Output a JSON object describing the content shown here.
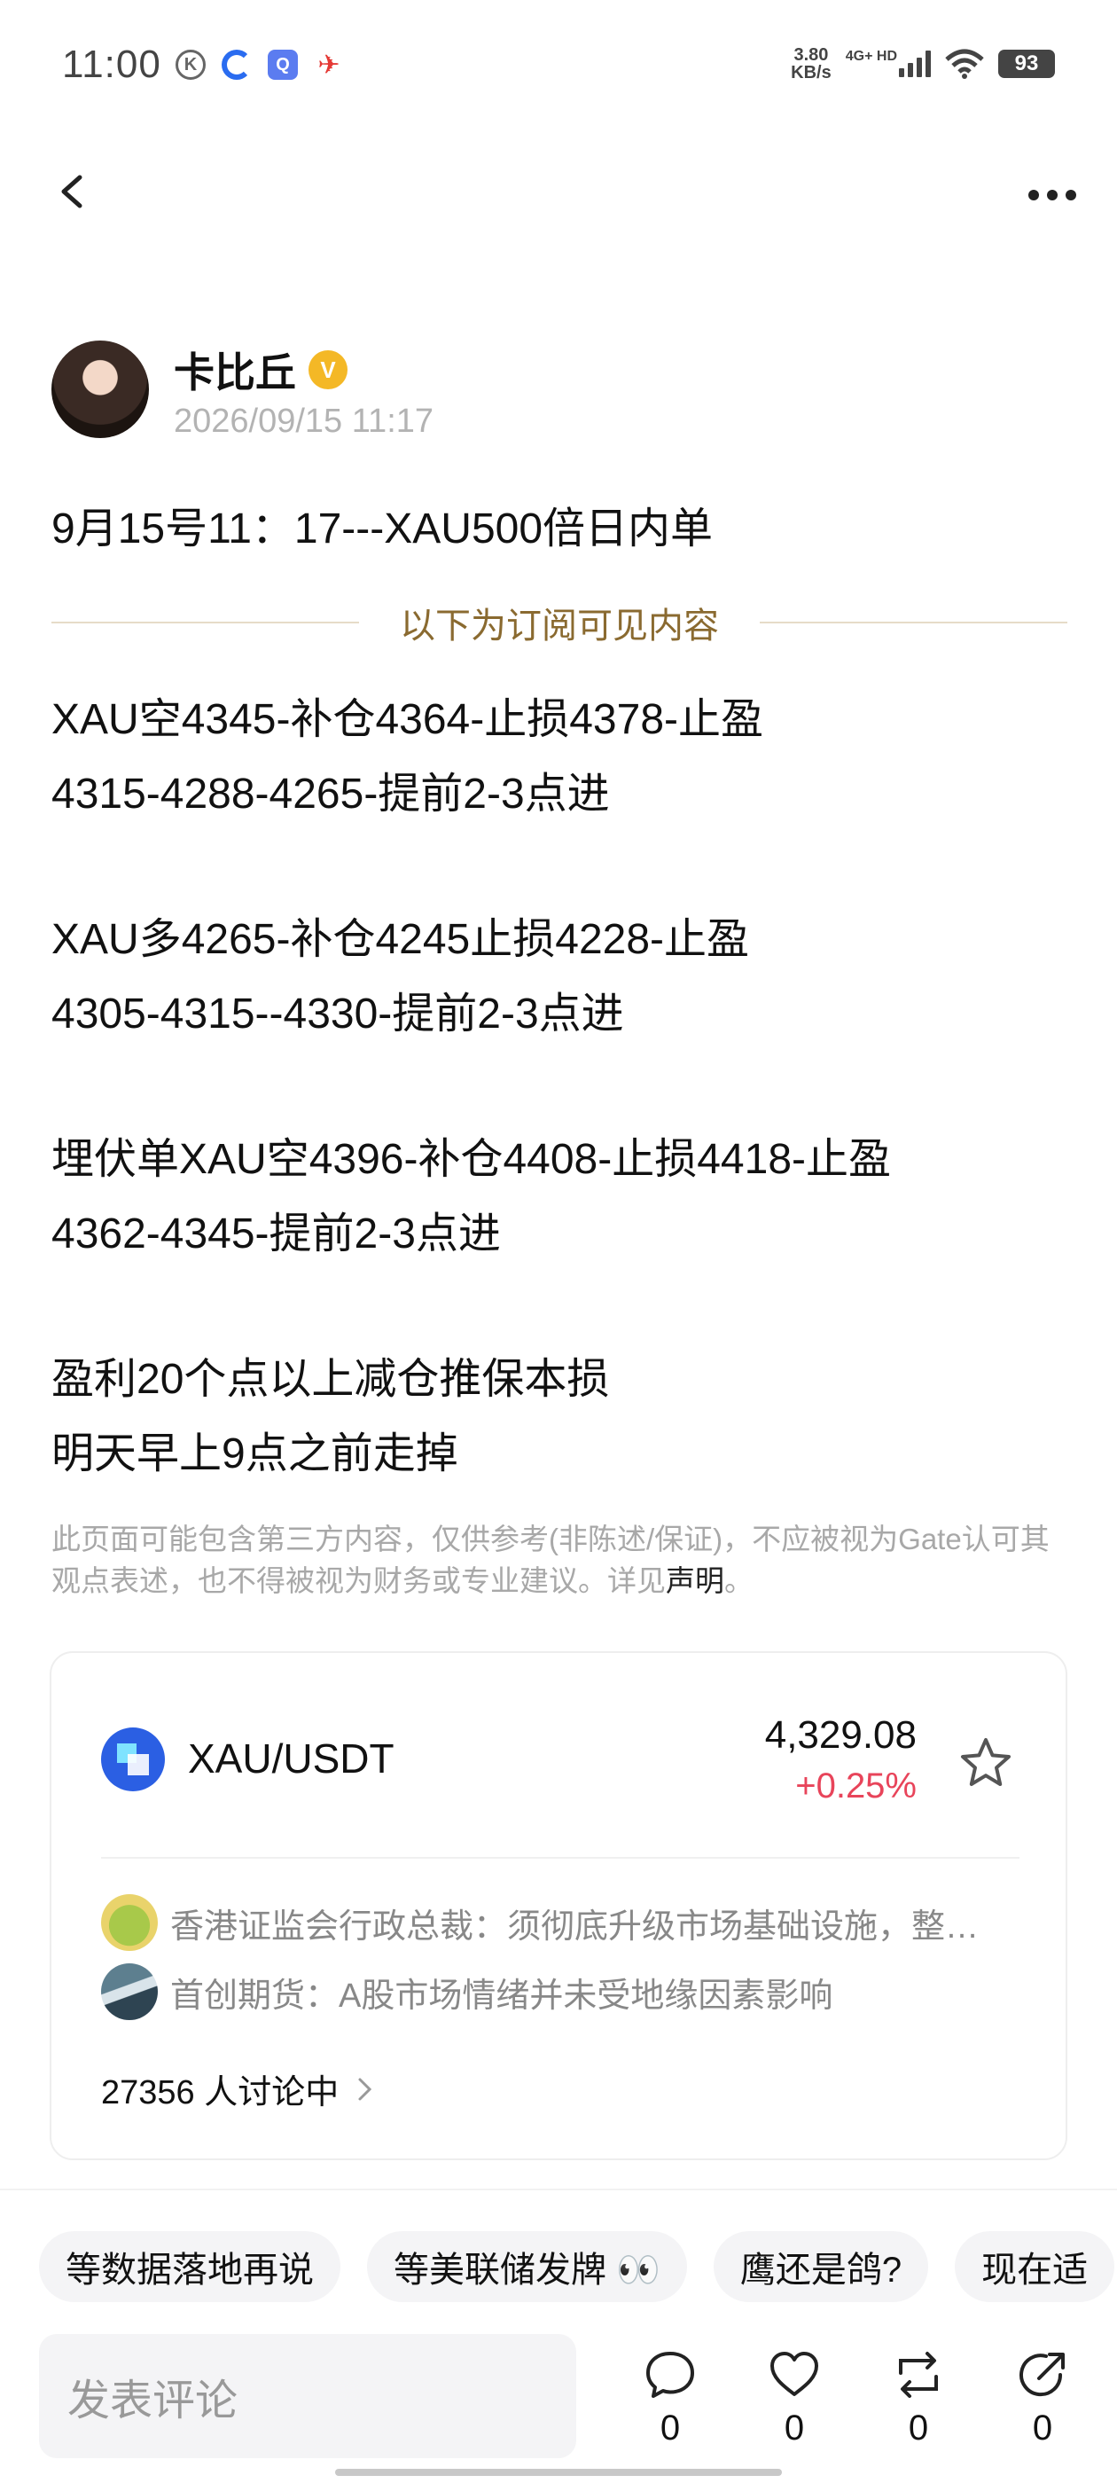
{
  "status_bar": {
    "time": "11:00",
    "net_speed_value": "3.80",
    "net_speed_unit": "KB/s",
    "signal_label": "4G+ HD",
    "battery": "93",
    "icons": [
      "k-app-icon",
      "c-app-icon",
      "q-app-icon",
      "plane-app-icon",
      "signal-icon",
      "wifi-icon",
      "battery-icon"
    ]
  },
  "nav": {
    "back_icon": "chevron-left-icon",
    "more_icon": "more-dots-icon"
  },
  "author": {
    "name": "卡比丘",
    "verified_mark": "V",
    "time": "2026/09/15 11:17"
  },
  "post": {
    "title": "9月15号11：17---XAU500倍日内单",
    "divider_text": "以下为订阅可见内容",
    "paragraphs": [
      [
        "XAU空4345-补仓4364-止损4378-止盈",
        "4315-4288-4265-提前2-3点进"
      ],
      [
        "XAU多4265-补仓4245止损4228-止盈",
        "4305-4315--4330-提前2-3点进"
      ],
      [
        "埋伏单XAU空4396-补仓4408-止损4418-止盈",
        "4362-4345-提前2-3点进"
      ],
      [
        "盈利20个点以上减仓推保本损",
        "明天早上9点之前走掉"
      ]
    ],
    "disclaimer": "此页面可能包含第三方内容，仅供参考(非陈述/保证)，不应被视为Gate认可其观点表述，也不得被视为财务或专业建议。详见",
    "disclaimer_link": "声明",
    "disclaimer_end": "。"
  },
  "market_card": {
    "pair": "XAU/USDT",
    "price": "4,329.08",
    "change": "+0.25%",
    "change_color": "#e8445a",
    "news": [
      "香港证监会行政总裁：须彻底升级市场基础设施，整…",
      "首创期货：A股市场情绪并未受地缘因素影响"
    ],
    "discussing": "27356 人讨论中"
  },
  "tags": [
    "等数据落地再说",
    "等美联储发牌 👀",
    "鹰还是鸽?",
    "现在适"
  ],
  "comment_placeholder": "发表评论",
  "actions": [
    {
      "icon": "comment-icon",
      "count": "0"
    },
    {
      "icon": "heart-icon",
      "count": "0"
    },
    {
      "icon": "repost-icon",
      "count": "0"
    },
    {
      "icon": "share-icon",
      "count": "0"
    }
  ]
}
